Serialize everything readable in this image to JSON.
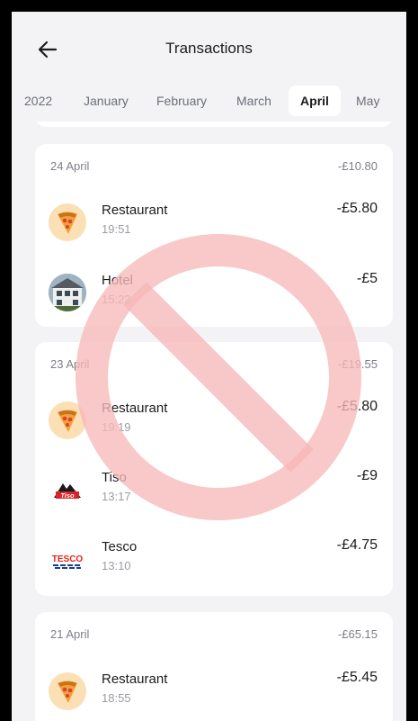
{
  "header": {
    "title": "Transactions",
    "months": [
      "2022",
      "January",
      "February",
      "March",
      "April",
      "May"
    ],
    "active_month": "April"
  },
  "days": [
    {
      "date": "24 April",
      "total": "-£10.80",
      "transactions": [
        {
          "name": "Restaurant",
          "time": "19:51",
          "amount": "-£5.80",
          "icon": "pizza-icon"
        },
        {
          "name": "Hotel",
          "time": "15:22",
          "amount": "-£5",
          "icon": "hotel-photo-icon"
        }
      ]
    },
    {
      "date": "23 April",
      "total": "-£19.55",
      "transactions": [
        {
          "name": "Restaurant",
          "time": "19:19",
          "amount": "-£5.80",
          "icon": "pizza-icon"
        },
        {
          "name": "Tiso",
          "time": "13:17",
          "amount": "-£9",
          "icon": "tiso-logo-icon"
        },
        {
          "name": "Tesco",
          "time": "13:10",
          "amount": "-£4.75",
          "icon": "tesco-logo-icon"
        }
      ]
    },
    {
      "date": "21 April",
      "total": "-£65.15",
      "transactions": [
        {
          "name": "Restaurant",
          "time": "18:55",
          "amount": "-£5.45",
          "icon": "pizza-icon"
        }
      ]
    }
  ],
  "logos": {
    "tiso": "Tiso",
    "tesco": "TESCO"
  },
  "colors": {
    "prohibit_overlay": "#f7b8b8",
    "pizza_bg": "#fbe0b6",
    "tesco_red": "#e2231a",
    "tesco_blue": "#1b3f8c"
  }
}
